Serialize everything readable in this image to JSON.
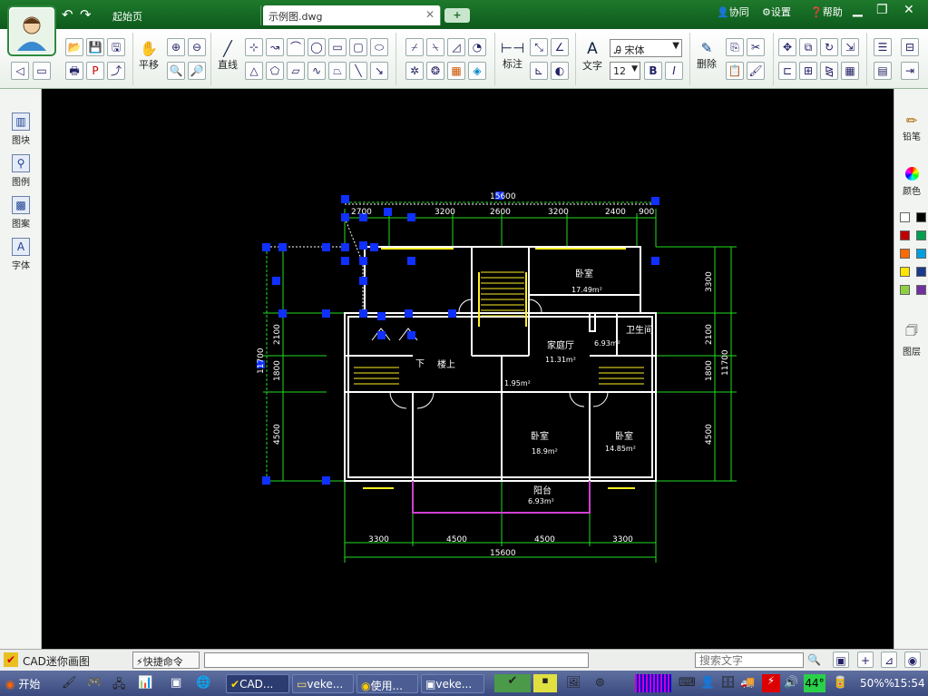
{
  "titlebar": {
    "tabs": [
      {
        "label": "起始页"
      },
      {
        "label": "示例图.dwg"
      }
    ],
    "new_tab_icon": "plus-icon",
    "menu": {
      "collab": "协同",
      "settings": "设置",
      "help": "帮助"
    }
  },
  "ribbon": {
    "pan_label": "平移",
    "line_label": "直线",
    "dim_label": "标注",
    "text_label": "文字",
    "font_name": "宋体",
    "font_size": "12",
    "bold": "B",
    "italic": "I",
    "delete_label": "删除"
  },
  "leftbar": {
    "items": [
      {
        "label": "图块"
      },
      {
        "label": "图例"
      },
      {
        "label": "图案"
      },
      {
        "label": "字体"
      }
    ]
  },
  "rightbar": {
    "pencil_label": "铅笔",
    "color_label": "颜色",
    "layers_label": "图层",
    "colors": [
      "#ffffff",
      "#000000",
      "#c00000",
      "#00a050",
      "#ff6a00",
      "#00a0e0",
      "#ffe600",
      "#1a3a8a",
      "#8fd040",
      "#7030a0"
    ]
  },
  "drawing": {
    "top_dims": [
      "2700",
      "3200",
      "2600",
      "3200",
      "2400",
      "900"
    ],
    "top_total": "15600",
    "bottom_dims": [
      "3300",
      "4500",
      "4500",
      "3300"
    ],
    "bottom_total": "15600",
    "left_dims": [
      "2100",
      "1800",
      "4500"
    ],
    "left_total": "11700",
    "right_dims": [
      "3300",
      "2100",
      "1800",
      "4500"
    ],
    "right_total": "11700",
    "rooms": [
      {
        "name": "卧室",
        "area": "17.49m²"
      },
      {
        "name": "家庭厅",
        "area": "11.31m²"
      },
      {
        "name": "卫生间",
        "area": "6.93m²"
      },
      {
        "name": "楼上",
        "area": ""
      },
      {
        "name": "卧室",
        "area": "18.9m²"
      },
      {
        "name": "卧室",
        "area": "14.85m²"
      },
      {
        "name": "阳台",
        "area": "6.93m²"
      }
    ],
    "stair_down": "下",
    "hall_area": "1.95m²"
  },
  "cmdbar": {
    "app_name": "CAD迷你画图",
    "quick_cmd": "快捷命令",
    "command_value": "",
    "search_placeholder": "搜索文字"
  },
  "taskbar": {
    "start": "开始",
    "tasks": [
      {
        "label": "CAD..."
      },
      {
        "label": "veke..."
      },
      {
        "label": "使用..."
      },
      {
        "label": "veke..."
      }
    ],
    "temp": "44°",
    "zoom": "50%%",
    "clock": "15:54"
  }
}
